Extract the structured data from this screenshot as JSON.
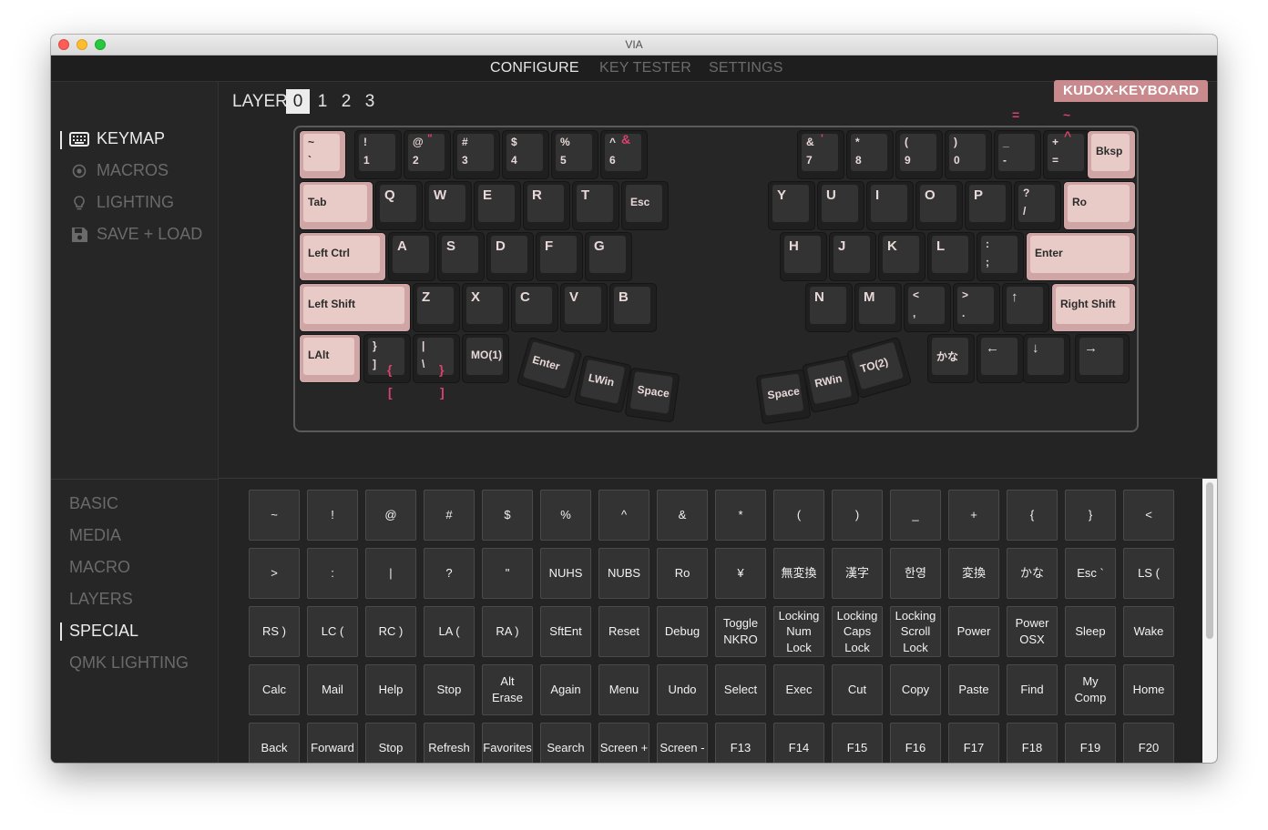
{
  "window": {
    "title": "VIA"
  },
  "menu": {
    "configure": "CONFIGURE",
    "key_tester": "KEY TESTER",
    "settings": "SETTINGS"
  },
  "nav": {
    "keymap": "KEYMAP",
    "macros": "MACROS",
    "lighting": "LIGHTING",
    "save_load": "SAVE + LOAD"
  },
  "layers": {
    "label": "LAYER",
    "items": [
      "0",
      "1",
      "2",
      "3"
    ],
    "selected": "0"
  },
  "keyboard_name": "KUDOX-KEYBOARD",
  "keyboard": {
    "pink_symbols": {
      "eq": "=",
      "tilde": "~",
      "amp": "&",
      "quote": "'",
      "caret": "^",
      "dquote": "\"",
      "lbrace": "{",
      "rbrace": "}",
      "lbracket": "[",
      "rbracket": "]"
    },
    "keys": [
      {
        "top": "~",
        "bottom": "`",
        "accent": true
      },
      {
        "top": "!",
        "bottom": "1"
      },
      {
        "top": "@",
        "bottom": "2"
      },
      {
        "top": "#",
        "bottom": "3"
      },
      {
        "top": "$",
        "bottom": "4"
      },
      {
        "top": "%",
        "bottom": "5"
      },
      {
        "top": "^",
        "bottom": "6"
      },
      {
        "top": "&",
        "bottom": "7"
      },
      {
        "top": "*",
        "bottom": "8"
      },
      {
        "top": "(",
        "bottom": "9"
      },
      {
        "top": ")",
        "bottom": "0"
      },
      {
        "top": "_",
        "bottom": "-"
      },
      {
        "top": "+",
        "bottom": "="
      },
      {
        "label": "Bksp",
        "accent": true
      },
      {
        "label": "Tab",
        "accent": true
      },
      {
        "label": "Q"
      },
      {
        "label": "W"
      },
      {
        "label": "E"
      },
      {
        "label": "R"
      },
      {
        "label": "T"
      },
      {
        "label": "Esc"
      },
      {
        "label": "Y"
      },
      {
        "label": "U"
      },
      {
        "label": "I"
      },
      {
        "label": "O"
      },
      {
        "label": "P"
      },
      {
        "top": "?",
        "bottom": "/"
      },
      {
        "label": "Ro",
        "accent": true
      },
      {
        "label": "Left Ctrl",
        "accent": true
      },
      {
        "label": "A"
      },
      {
        "label": "S"
      },
      {
        "label": "D"
      },
      {
        "label": "F"
      },
      {
        "label": "G"
      },
      {
        "label": "H"
      },
      {
        "label": "J"
      },
      {
        "label": "K"
      },
      {
        "label": "L"
      },
      {
        "top": ":",
        "bottom": ";"
      },
      {
        "label": "Enter",
        "accent": true
      },
      {
        "label": "Left Shift",
        "accent": true
      },
      {
        "label": "Z"
      },
      {
        "label": "X"
      },
      {
        "label": "C"
      },
      {
        "label": "V"
      },
      {
        "label": "B"
      },
      {
        "label": "N"
      },
      {
        "label": "M"
      },
      {
        "top": "<",
        "bottom": ","
      },
      {
        "top": ">",
        "bottom": "."
      },
      {
        "label": "↑"
      },
      {
        "label": "Right Shift",
        "accent": true
      },
      {
        "label": "LAlt",
        "accent": true
      },
      {
        "top": "}",
        "bottom": "]"
      },
      {
        "top": "|",
        "bottom": "\\"
      },
      {
        "label": "MO(1)"
      },
      {
        "label": "Enter"
      },
      {
        "label": "LWin"
      },
      {
        "label": "Space"
      },
      {
        "label": "Space"
      },
      {
        "label": "RWin"
      },
      {
        "label": "TO(2)"
      },
      {
        "label": "かな"
      },
      {
        "label": "←"
      },
      {
        "label": "↓"
      },
      {
        "label": "→"
      }
    ]
  },
  "categories": [
    "BASIC",
    "MEDIA",
    "MACRO",
    "LAYERS",
    "SPECIAL",
    "QMK LIGHTING"
  ],
  "selected_category": "SPECIAL",
  "palette": [
    "~",
    "!",
    "@",
    "#",
    "$",
    "%",
    "^",
    "&",
    "*",
    "(",
    ")",
    "_",
    "+",
    "{",
    "}",
    "<",
    ">",
    ":",
    "|",
    "?",
    "\"",
    "NUHS",
    "NUBS",
    "Ro",
    "¥",
    "無変換",
    "漢字",
    "한영",
    "変換",
    "かな",
    "Esc `",
    "LS (",
    "RS )",
    "LC (",
    "RC )",
    "LA (",
    "RA )",
    "SftEnt",
    "Reset",
    "Debug",
    "Toggle\nNKRO",
    "Locking\nNum\nLock",
    "Locking\nCaps\nLock",
    "Locking\nScroll\nLock",
    "Power",
    "Power\nOSX",
    "Sleep",
    "Wake",
    "Calc",
    "Mail",
    "Help",
    "Stop",
    "Alt\nErase",
    "Again",
    "Menu",
    "Undo",
    "Select",
    "Exec",
    "Cut",
    "Copy",
    "Paste",
    "Find",
    "My\nComp",
    "Home",
    "Back",
    "Forward",
    "Stop",
    "Refresh",
    "Favorites",
    "Search",
    "Screen +",
    "Screen -",
    "F13",
    "F14",
    "F15",
    "F16",
    "F17",
    "F18",
    "F19",
    "F20"
  ],
  "colors": {
    "accent": "#e8cbc7",
    "badge": "#c98a8d",
    "pink_legend": "#d8436c",
    "background": "#242424"
  }
}
